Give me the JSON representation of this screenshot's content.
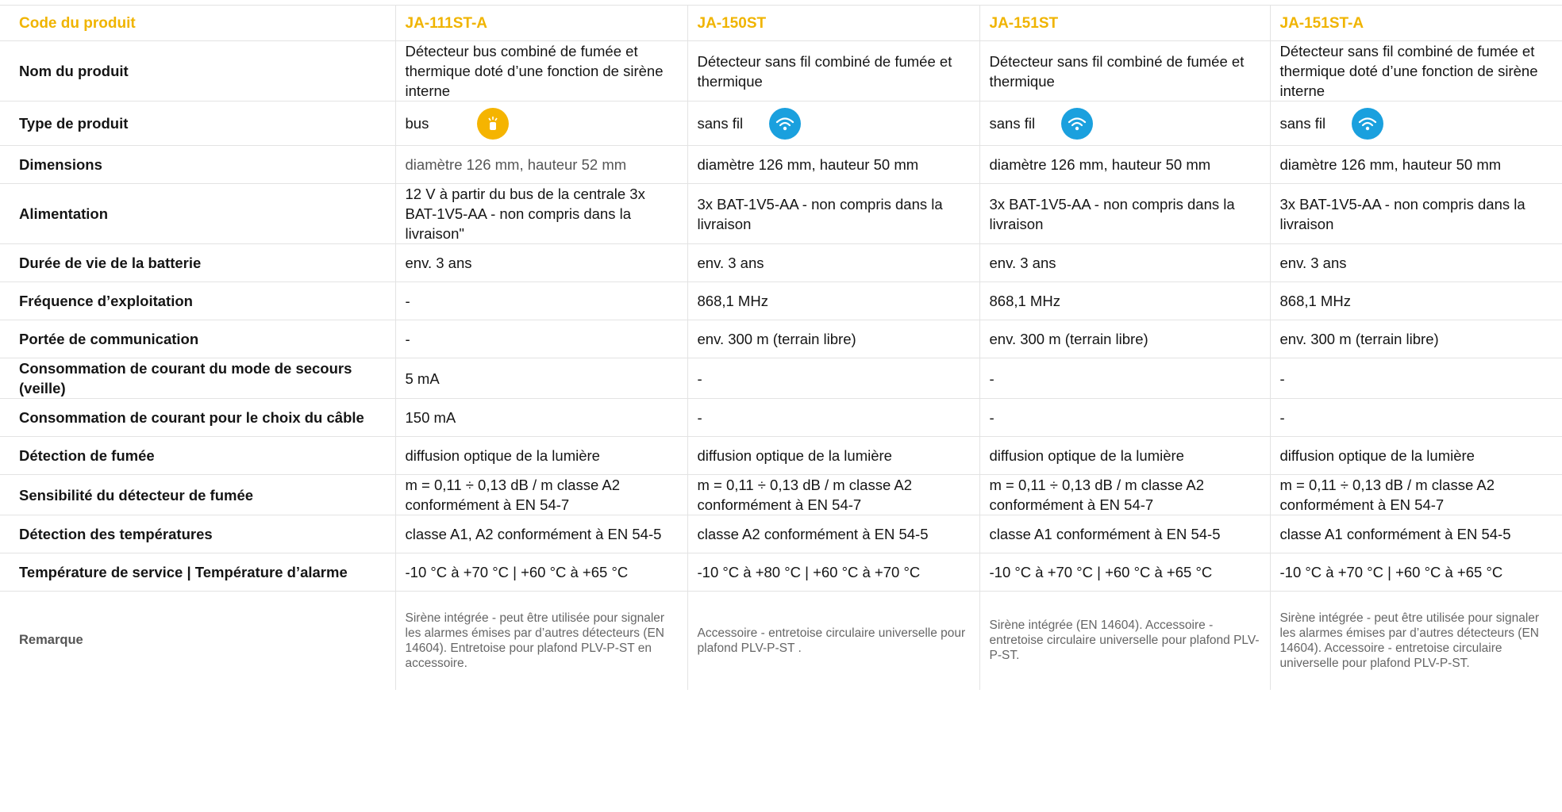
{
  "header": {
    "label": "Code du produit",
    "products": [
      "JA-111ST-A",
      "JA-150ST",
      "JA-151ST",
      "JA-151ST-A"
    ]
  },
  "rows": [
    {
      "label": "Nom du produit",
      "values": [
        "Détecteur bus combiné de fumée et thermique doté d’une fonction de sirène interne",
        "Détecteur sans fil combiné de fumée et thermique",
        "Détecteur sans fil combiné de fumée et thermique",
        "Détecteur sans fil combiné de fumée et thermique doté d’une fonction de sirène interne"
      ]
    },
    {
      "label": "Type de produit",
      "values": [
        "bus",
        "sans fil",
        "sans fil",
        "sans fil"
      ],
      "icons": [
        "bus-icon",
        "wireless-icon",
        "wireless-icon",
        "wireless-icon"
      ]
    },
    {
      "label": "Dimensions",
      "values": [
        "diamètre 126 mm, hauteur 52 mm",
        "diamètre 126 mm, hauteur 50 mm",
        "diamètre 126 mm, hauteur 50 mm",
        "diamètre 126 mm, hauteur 50 mm"
      ]
    },
    {
      "label": "Alimentation",
      "values": [
        "12 V à partir du bus de la centrale 3x BAT-1V5-AA - non compris dans la livraison\"",
        "3x BAT-1V5-AA - non compris dans la livraison",
        "3x BAT-1V5-AA - non compris dans la livraison",
        "3x BAT-1V5-AA - non compris dans la livraison"
      ]
    },
    {
      "label": "Durée de vie de la batterie",
      "values": [
        "env. 3 ans",
        "env. 3 ans",
        "env. 3 ans",
        "env. 3 ans"
      ]
    },
    {
      "label": "Fréquence d’exploitation",
      "values": [
        "-",
        "868,1 MHz",
        "868,1 MHz",
        "868,1 MHz"
      ]
    },
    {
      "label": "Portée de communication",
      "values": [
        "-",
        "env. 300 m (terrain libre)",
        "env. 300 m (terrain libre)",
        "env. 300 m (terrain libre)"
      ]
    },
    {
      "label": "Consommation de courant du mode de secours (veille)",
      "values": [
        "5 mA",
        "-",
        "-",
        "-"
      ]
    },
    {
      "label": "Consommation de courant pour le choix du câble",
      "values": [
        "150 mA",
        "-",
        "-",
        "-"
      ]
    },
    {
      "label": "Détection de fumée",
      "values": [
        "diffusion optique de la lumière",
        "diffusion optique de la lumière",
        "diffusion optique de la lumière",
        "diffusion optique de la lumière"
      ]
    },
    {
      "label": "Sensibilité du détecteur de fumée",
      "values": [
        "m = 0,11 ÷ 0,13 dB / m classe A2 conformément à EN 54-7",
        "m = 0,11 ÷ 0,13 dB / m classe A2 conformément à EN 54-7",
        "m = 0,11 ÷ 0,13 dB / m classe A2 conformément à EN 54-7",
        "m = 0,11 ÷ 0,13 dB / m classe A2 conformément à EN 54-7"
      ]
    },
    {
      "label": "Détection des températures",
      "values": [
        "classe A1, A2 conformément à EN 54-5",
        "classe A2 conformément à EN 54-5",
        "classe A1 conformément à EN 54-5",
        "classe A1 conformément à EN 54-5"
      ]
    },
    {
      "label": "Température de service | Température d’alarme",
      "values": [
        "-10 °C à +70 °C | +60 °C à +65 °C",
        "-10 °C à +80 °C | +60 °C à +70 °C",
        "-10 °C à +70 °C | +60 °C à +65 °C",
        "-10 °C à +70 °C | +60 °C à +65 °C"
      ]
    },
    {
      "label": "Remarque",
      "values": [
        "Sirène intégrée - peut être utilisée pour signaler les alarmes émises par d’autres détecteurs (EN 14604). Entretoise pour plafond PLV-P-ST en accessoire.",
        "Accessoire - entretoise circulaire universelle pour plafond PLV-P-ST .",
        "Sirène intégrée (EN 14604). Accessoire - entretoise circulaire universelle pour plafond PLV-P-ST.",
        "Sirène intégrée - peut être utilisée pour signaler les alarmes émises par d’autres détecteurs (EN 14604). Accessoire - entretoise circulaire universelle pour plafond PLV-P-ST."
      ]
    }
  ],
  "colors": {
    "accent": "#f0b400",
    "bus_icon": "#f5b400",
    "wireless_icon": "#1aa0de"
  }
}
